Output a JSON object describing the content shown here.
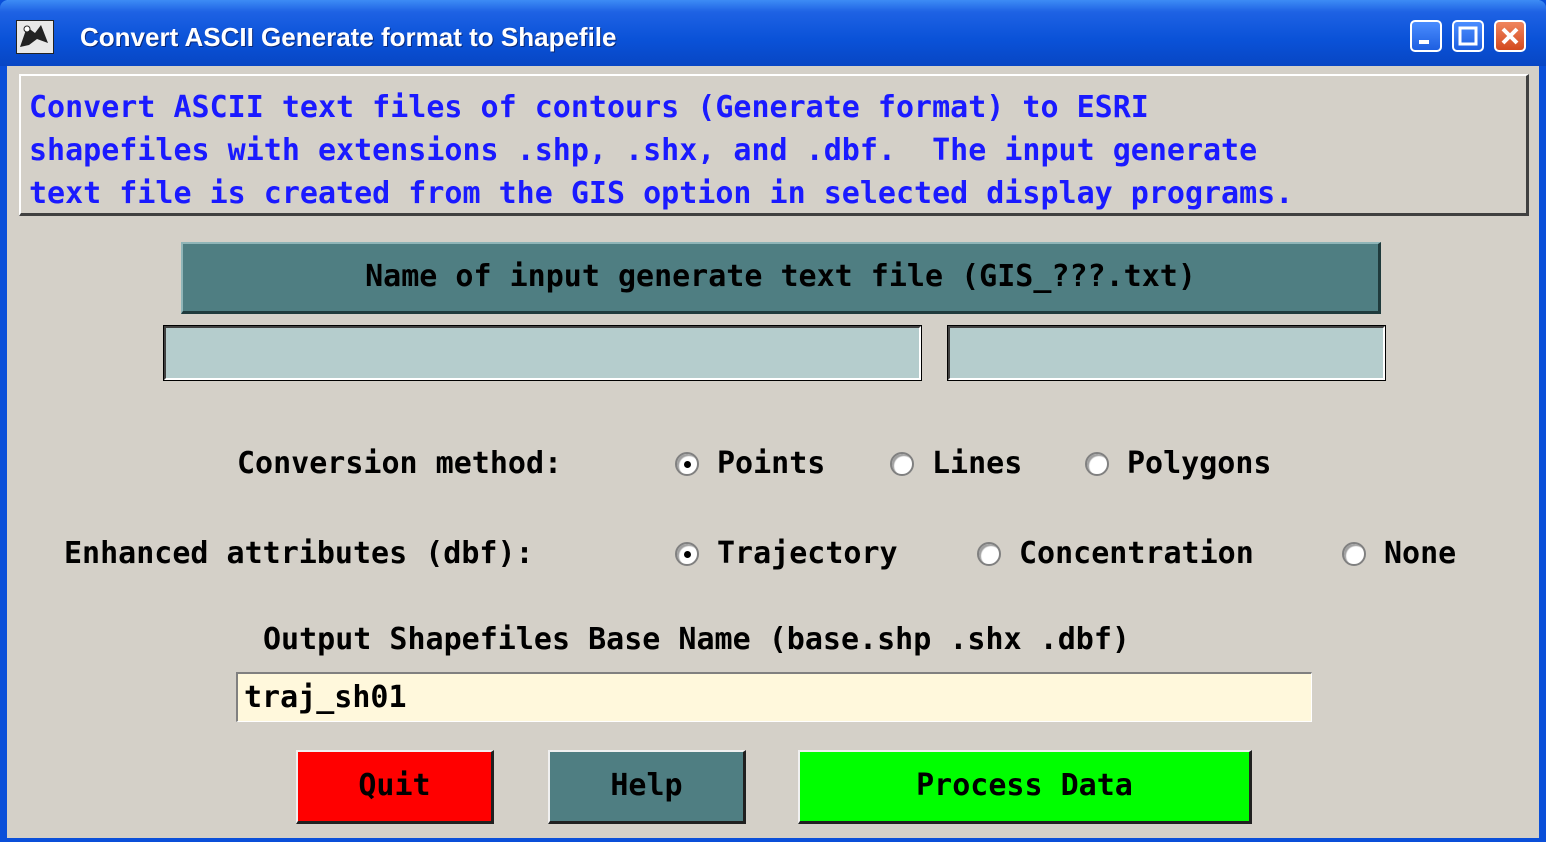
{
  "window": {
    "title": "Convert ASCII Generate format to Shapefile",
    "icons": {
      "app": "app-icon",
      "minimize": "minimize-icon",
      "maximize": "maximize-icon",
      "close": "close-icon"
    }
  },
  "info": {
    "lines": [
      "Convert ASCII text files of contours (Generate format) to ESRI",
      "shapefiles with extensions .shp, .shx, and .dbf.  The input generate",
      "text file is created from the GIS option in selected display programs."
    ]
  },
  "input": {
    "label": "Name of input generate text file (GIS_???.txt)",
    "directory_value": "",
    "filename_value": ""
  },
  "conversion": {
    "label": "Conversion method:",
    "options": [
      "Points",
      "Lines",
      "Polygons"
    ],
    "selected": "Points"
  },
  "attributes": {
    "label": "Enhanced attributes (dbf):",
    "options": [
      "Trajectory",
      "Concentration",
      "None"
    ],
    "selected": "Trajectory"
  },
  "output": {
    "label": "Output Shapefiles Base Name (base.shp .shx .dbf)",
    "value": "traj_sh01"
  },
  "buttons": {
    "quit": "Quit",
    "help": "Help",
    "process": "Process Data"
  },
  "colors": {
    "title_bar": "#0a52d8",
    "info_text": "#1a1aff",
    "teal": "#4f7e82",
    "field_bg": "#b5cdcd",
    "output_bg": "#fff8dc",
    "quit": "#ff0000",
    "process": "#00ff00"
  }
}
